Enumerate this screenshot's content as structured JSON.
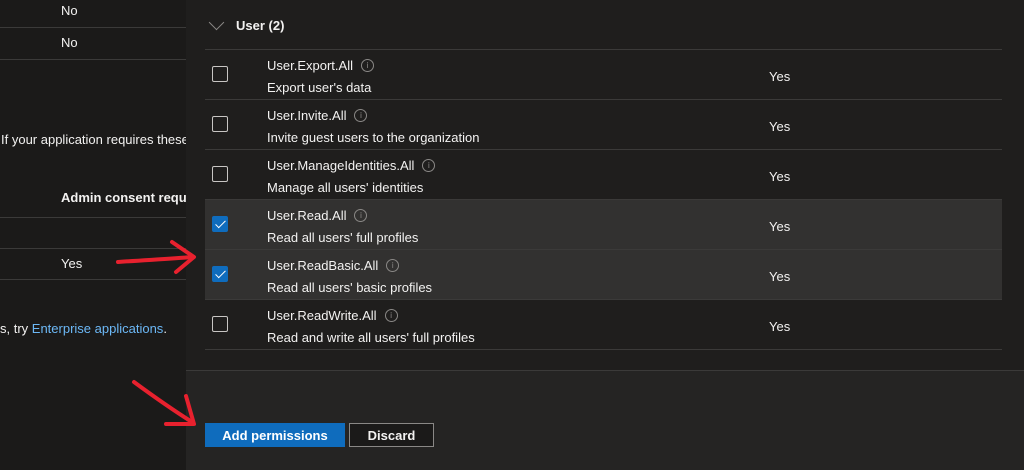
{
  "background": {
    "rows": [
      {
        "value": "No"
      },
      {
        "value": "No"
      }
    ],
    "requires_text": "If your application requires these",
    "admin_consent_header": "Admin consent requ...",
    "selected_row_value": "Yes",
    "try_text": "s, try ",
    "enterprise_link": "Enterprise applications",
    "period": "."
  },
  "panel": {
    "group": {
      "label": "User (2)"
    },
    "permissions": [
      {
        "name": "User.Export.All",
        "description": "Export user's data",
        "admin_consent": "Yes",
        "checked": false
      },
      {
        "name": "User.Invite.All",
        "description": "Invite guest users to the organization",
        "admin_consent": "Yes",
        "checked": false
      },
      {
        "name": "User.ManageIdentities.All",
        "description": "Manage all users' identities",
        "admin_consent": "Yes",
        "checked": false
      },
      {
        "name": "User.Read.All",
        "description": "Read all users' full profiles",
        "admin_consent": "Yes",
        "checked": true
      },
      {
        "name": "User.ReadBasic.All",
        "description": "Read all users' basic profiles",
        "admin_consent": "Yes",
        "checked": true
      },
      {
        "name": "User.ReadWrite.All",
        "description": "Read and write all users' full profiles",
        "admin_consent": "Yes",
        "checked": false
      }
    ],
    "buttons": {
      "add_label": "Add permissions",
      "discard_label": "Discard"
    }
  },
  "info_glyph": "i",
  "colors": {
    "accent": "#0f6cbd",
    "annotation_arrow": "#e8212e"
  }
}
